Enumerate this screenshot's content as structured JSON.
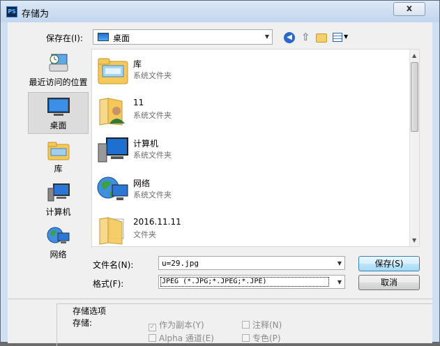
{
  "window": {
    "title": "存储为",
    "app_icon": "PS",
    "close_label": "x"
  },
  "location": {
    "label": "保存在(I):",
    "value": "桌面"
  },
  "toolbar": {
    "icons": [
      "back-icon",
      "up-folder-icon",
      "new-folder-icon",
      "view-menu-icon"
    ]
  },
  "places": [
    {
      "label": "最近访问的位置",
      "icon": "recent-places-icon",
      "active": false
    },
    {
      "label": "桌面",
      "icon": "desktop-icon",
      "active": true
    },
    {
      "label": "库",
      "icon": "libraries-icon",
      "active": false
    },
    {
      "label": "计算机",
      "icon": "computer-icon",
      "active": false
    },
    {
      "label": "网络",
      "icon": "network-icon",
      "active": false
    }
  ],
  "files": [
    {
      "name": "库",
      "type": "系统文件夹",
      "icon": "libraries-folder-icon"
    },
    {
      "name": "11",
      "type": "系统文件夹",
      "icon": "user-folder-icon"
    },
    {
      "name": "计算机",
      "type": "系统文件夹",
      "icon": "computer-icon"
    },
    {
      "name": "网络",
      "type": "系统文件夹",
      "icon": "network-globe-icon"
    },
    {
      "name": "2016.11.11",
      "type": "文件夹",
      "icon": "folder-icon"
    }
  ],
  "fields": {
    "filename_label": "文件名(N):",
    "filename_value": "u=29.jpg",
    "format_label": "格式(F):",
    "format_value": "JPEG (*.JPG;*.JPEG;*.JPE)"
  },
  "buttons": {
    "save": "保存(S)",
    "cancel": "取消"
  },
  "options": {
    "section_title": "存储选项",
    "store_label": "存储:",
    "as_copy": "作为副本(Y)",
    "annotations": "注释(N)",
    "alpha": "Alpha 通道(E)",
    "spot": "专色(P)"
  },
  "colors": {
    "accent": "#3c7fb1",
    "title_bar": "#cfe0f3"
  }
}
